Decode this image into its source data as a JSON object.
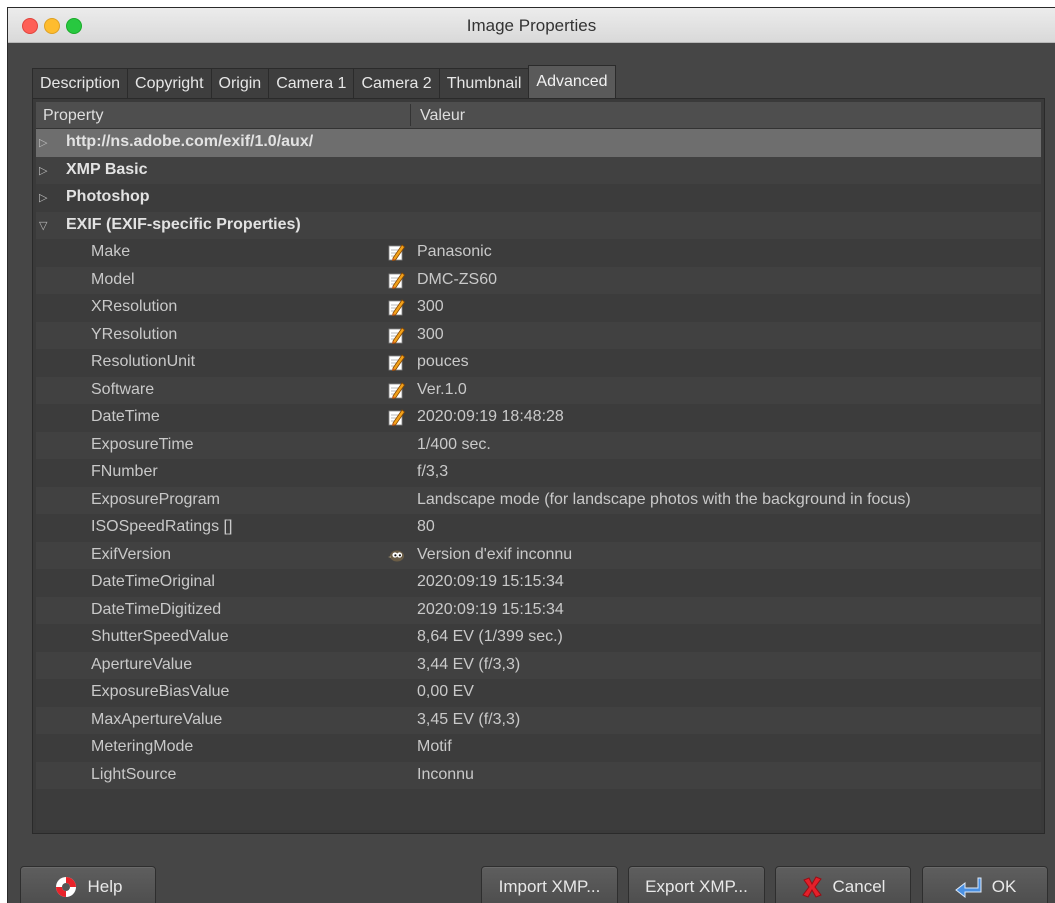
{
  "window": {
    "title": "Image Properties"
  },
  "tabs": [
    {
      "label": "Description"
    },
    {
      "label": "Copyright"
    },
    {
      "label": "Origin"
    },
    {
      "label": "Camera 1"
    },
    {
      "label": "Camera 2"
    },
    {
      "label": "Thumbnail"
    },
    {
      "label": "Advanced",
      "active": true
    }
  ],
  "table": {
    "headers": {
      "property": "Property",
      "value": "Valeur"
    },
    "groups": [
      {
        "label": "http://ns.adobe.com/exif/1.0/aux/",
        "expanded": false
      },
      {
        "label": "XMP Basic",
        "expanded": false
      },
      {
        "label": "Photoshop",
        "expanded": false
      },
      {
        "label": "EXIF (EXIF-specific Properties)",
        "expanded": true
      }
    ],
    "rows": [
      {
        "property": "Make",
        "value": "Panasonic",
        "icon": "edit-icon"
      },
      {
        "property": "Model",
        "value": "DMC-ZS60",
        "icon": "edit-icon"
      },
      {
        "property": "XResolution",
        "value": "300",
        "icon": "edit-icon"
      },
      {
        "property": "YResolution",
        "value": "300",
        "icon": "edit-icon"
      },
      {
        "property": "ResolutionUnit",
        "value": "pouces",
        "icon": "edit-icon"
      },
      {
        "property": "Software",
        "value": "Ver.1.0",
        "icon": "edit-icon"
      },
      {
        "property": "DateTime",
        "value": "2020:09:19 18:48:28",
        "icon": "edit-icon"
      },
      {
        "property": "ExposureTime",
        "value": "1/400 sec."
      },
      {
        "property": "FNumber",
        "value": "f/3,3"
      },
      {
        "property": "ExposureProgram",
        "value": "Landscape mode (for landscape photos with the background in focus)"
      },
      {
        "property": "ISOSpeedRatings []",
        "value": "80"
      },
      {
        "property": "ExifVersion",
        "value": "Version d'exif inconnu",
        "icon": "gimp-icon"
      },
      {
        "property": "DateTimeOriginal",
        "value": "2020:09:19 15:15:34"
      },
      {
        "property": "DateTimeDigitized",
        "value": "2020:09:19 15:15:34"
      },
      {
        "property": "ShutterSpeedValue",
        "value": "8,64 EV (1/399 sec.)"
      },
      {
        "property": "ApertureValue",
        "value": "3,44 EV (f/3,3)"
      },
      {
        "property": "ExposureBiasValue",
        "value": "0,00 EV"
      },
      {
        "property": "MaxApertureValue",
        "value": "3,45 EV (f/3,3)"
      },
      {
        "property": "MeteringMode",
        "value": "Motif"
      },
      {
        "property": "LightSource",
        "value": "Inconnu"
      }
    ]
  },
  "buttons": {
    "help": "Help",
    "import": "Import XMP...",
    "export": "Export XMP...",
    "cancel": "Cancel",
    "ok": "OK"
  }
}
